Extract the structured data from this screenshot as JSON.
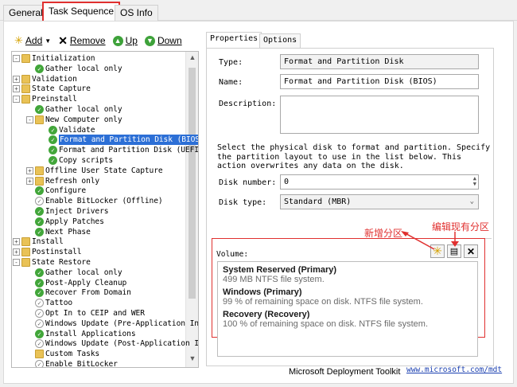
{
  "tabs": [
    "General",
    "Task Sequence",
    "OS Info"
  ],
  "toolbar": {
    "add": "Add",
    "remove": "Remove",
    "up": "Up",
    "down": "Down"
  },
  "tree": [
    {
      "label": "Initialization",
      "icon": "folder",
      "indent": 0,
      "exp": "-"
    },
    {
      "label": "Gather local only",
      "icon": "check",
      "indent": 1
    },
    {
      "label": "Validation",
      "icon": "folder",
      "indent": 0,
      "exp": "+"
    },
    {
      "label": "State Capture",
      "icon": "folder",
      "indent": 0,
      "exp": "+"
    },
    {
      "label": "Preinstall",
      "icon": "folder",
      "indent": 0,
      "exp": "-"
    },
    {
      "label": "Gather local only",
      "icon": "check",
      "indent": 1
    },
    {
      "label": "New Computer only",
      "icon": "folder",
      "indent": 1,
      "exp": "-"
    },
    {
      "label": "Validate",
      "icon": "check",
      "indent": 2
    },
    {
      "label": "Format and Partition Disk (BIOS",
      "icon": "check",
      "indent": 2,
      "selected": true
    },
    {
      "label": "Format and Partition Disk (UEFI",
      "icon": "check",
      "indent": 2
    },
    {
      "label": "Copy scripts",
      "icon": "check",
      "indent": 2
    },
    {
      "label": "Offline User State Capture",
      "icon": "folder",
      "indent": 1,
      "exp": "+"
    },
    {
      "label": "Refresh only",
      "icon": "folder",
      "indent": 1,
      "exp": "+"
    },
    {
      "label": "Configure",
      "icon": "check",
      "indent": 1
    },
    {
      "label": "Enable BitLocker (Offline)",
      "icon": "gray",
      "indent": 1
    },
    {
      "label": "Inject Drivers",
      "icon": "check",
      "indent": 1
    },
    {
      "label": "Apply Patches",
      "icon": "check",
      "indent": 1
    },
    {
      "label": "Next Phase",
      "icon": "check",
      "indent": 1
    },
    {
      "label": "Install",
      "icon": "folder",
      "indent": 0,
      "exp": "+"
    },
    {
      "label": "Postinstall",
      "icon": "folder",
      "indent": 0,
      "exp": "+"
    },
    {
      "label": "State Restore",
      "icon": "folder",
      "indent": 0,
      "exp": "-"
    },
    {
      "label": "Gather local only",
      "icon": "check",
      "indent": 1
    },
    {
      "label": "Post-Apply Cleanup",
      "icon": "check",
      "indent": 1
    },
    {
      "label": "Recover From Domain",
      "icon": "check",
      "indent": 1
    },
    {
      "label": "Tattoo",
      "icon": "gray",
      "indent": 1
    },
    {
      "label": "Opt In to CEIP and WER",
      "icon": "gray",
      "indent": 1
    },
    {
      "label": "Windows Update (Pre-Application In",
      "icon": "gray",
      "indent": 1
    },
    {
      "label": "Install Applications",
      "icon": "check",
      "indent": 1
    },
    {
      "label": "Windows Update (Post-Application I",
      "icon": "gray",
      "indent": 1
    },
    {
      "label": "Custom Tasks",
      "icon": "folder",
      "indent": 1
    },
    {
      "label": "Enable BitLocker",
      "icon": "gray",
      "indent": 1
    }
  ],
  "props_tabs": [
    "Properties",
    "Options"
  ],
  "props": {
    "type_label": "Type:",
    "type_value": "Format and Partition Disk",
    "name_label": "Name:",
    "name_value": "Format and Partition Disk (BIOS)",
    "desc_label": "Description:",
    "desc_value": "",
    "instructions": "Select the physical disk to format and partition.  Specify the partition layout to use in the list below. This action overwrites any data on the disk.",
    "disk_number_label": "Disk number:",
    "disk_number_value": "0",
    "disk_type_label": "Disk type:",
    "disk_type_value": "Standard (MBR)",
    "volume_label": "Volume:"
  },
  "volumes": [
    {
      "name": "System Reserved (Primary)",
      "desc": "499 MB NTFS file system."
    },
    {
      "name": "Windows (Primary)",
      "desc": "99 % of remaining space on disk. NTFS file system."
    },
    {
      "name": "Recovery (Recovery)",
      "desc": "100 % of remaining space on disk. NTFS file system."
    }
  ],
  "annotations": {
    "new_partition": "新增分区",
    "edit_partition": "编辑现有分区"
  },
  "footer": {
    "product": "Microsoft Deployment Toolkit",
    "link": "www.microsoft.com/mdt"
  },
  "colors": {
    "accent_red": "#e0302f",
    "selection": "#2c6fd6",
    "check_green": "#42a63a"
  }
}
